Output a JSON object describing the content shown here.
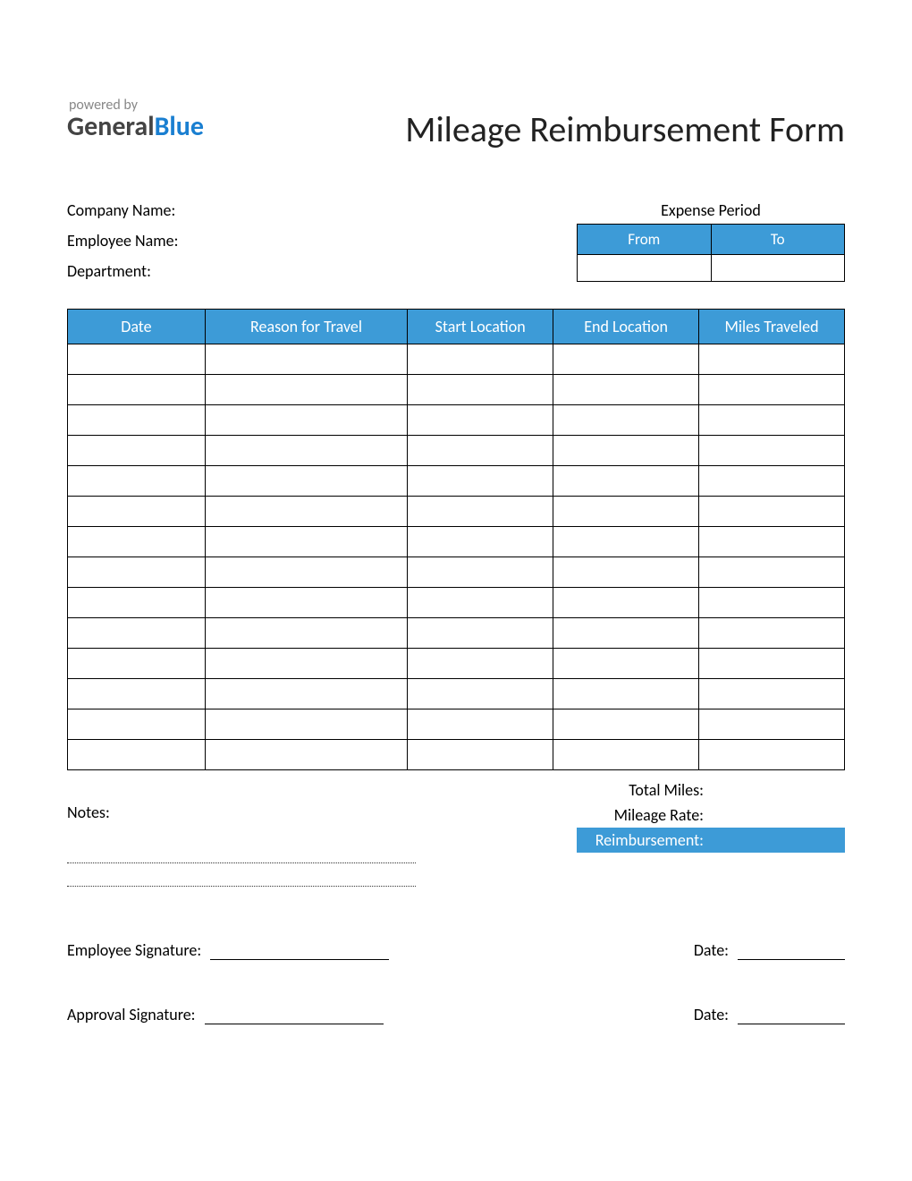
{
  "logo": {
    "powered": "powered by",
    "part1": "General",
    "part2": "Blue"
  },
  "title": "Mileage Reimbursement Form",
  "info": {
    "company_label": "Company Name:",
    "employee_label": "Employee Name:",
    "department_label": "Department:"
  },
  "period": {
    "title": "Expense Period",
    "from_label": "From",
    "to_label": "To",
    "from_value": "",
    "to_value": ""
  },
  "table": {
    "headers": {
      "date": "Date",
      "reason": "Reason for Travel",
      "start": "Start Location",
      "end": "End Location",
      "miles": "Miles Traveled"
    },
    "row_count": 14
  },
  "notes_label": "Notes:",
  "totals": {
    "total_miles_label": "Total Miles:",
    "mileage_rate_label": "Mileage Rate:",
    "reimbursement_label": "Reimbursement:",
    "total_miles_value": "",
    "mileage_rate_value": "",
    "reimbursement_value": ""
  },
  "signatures": {
    "employee_label": "Employee Signature:",
    "approval_label": "Approval Signature:",
    "date_label": "Date:"
  }
}
